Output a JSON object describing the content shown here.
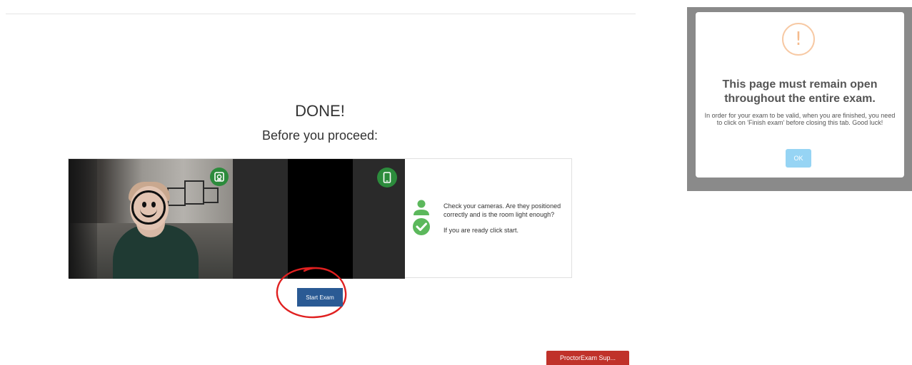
{
  "main": {
    "title": "DONE!",
    "subtitle": "Before you proceed:",
    "instructions": {
      "line1": "Check your cameras. Are they positioned correctly and is the room light enough?",
      "line2": "If you are ready click start."
    },
    "start_button_label": "Start Exam",
    "support_button_label": "ProctorExam Sup..."
  },
  "modal": {
    "title": "This page must remain open throughout the entire exam.",
    "message": "In order for your exam to be valid, when you are finished, you need to click on 'Finish exam' before closing this tab. Good luck!",
    "ok_label": "OK",
    "icon": "exclamation-icon"
  },
  "colors": {
    "primary_button": "#2a5a94",
    "support_button": "#c0322a",
    "success_green": "#2c8b3c",
    "status_green": "#5cb85c",
    "warning_orange": "#f5bb8d",
    "ok_button": "#96d4f4",
    "annotation_red": "#e02020"
  },
  "icons": {
    "webcam": "webcam-icon",
    "phone": "phone-icon",
    "person": "person-icon",
    "check": "check-circle-icon"
  }
}
